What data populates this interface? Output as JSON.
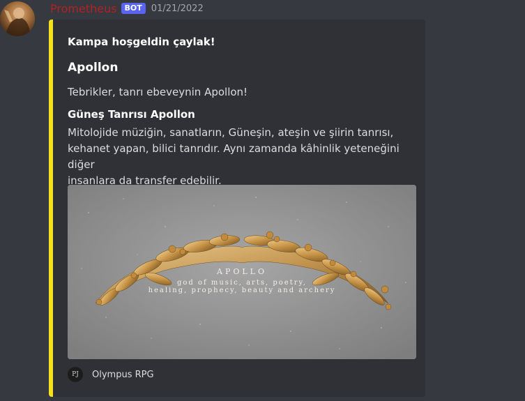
{
  "message": {
    "username": "Prometheus",
    "bot_tag": "BOT",
    "timestamp": "01/21/2022"
  },
  "embed": {
    "accent_color": "#f5e21c",
    "author": "Kampa hoşgeldin çaylak!",
    "title": "Apollon",
    "description": "Tebrikler, tanrı ebeveynin Apollon!",
    "field": {
      "name": "Güneş Tanrısı Apollon",
      "value_lines": [
        "Mitolojide müziğin, sanatların, Güneşin, ateşin ve şiirin tanrısı,",
        "kehanet yapan, bilici tanrıdır. Aynı zamanda kâhinlik yeteneğini diğer",
        "insanlara da transfer edebilir."
      ]
    },
    "image": {
      "title": "APOLLO",
      "subtitle_lines": [
        "god of music, arts, poetry,",
        "healing, prophecy, beauty and archery"
      ]
    },
    "footer": {
      "icon_text": "PJ",
      "text": "Olympus RPG"
    }
  }
}
